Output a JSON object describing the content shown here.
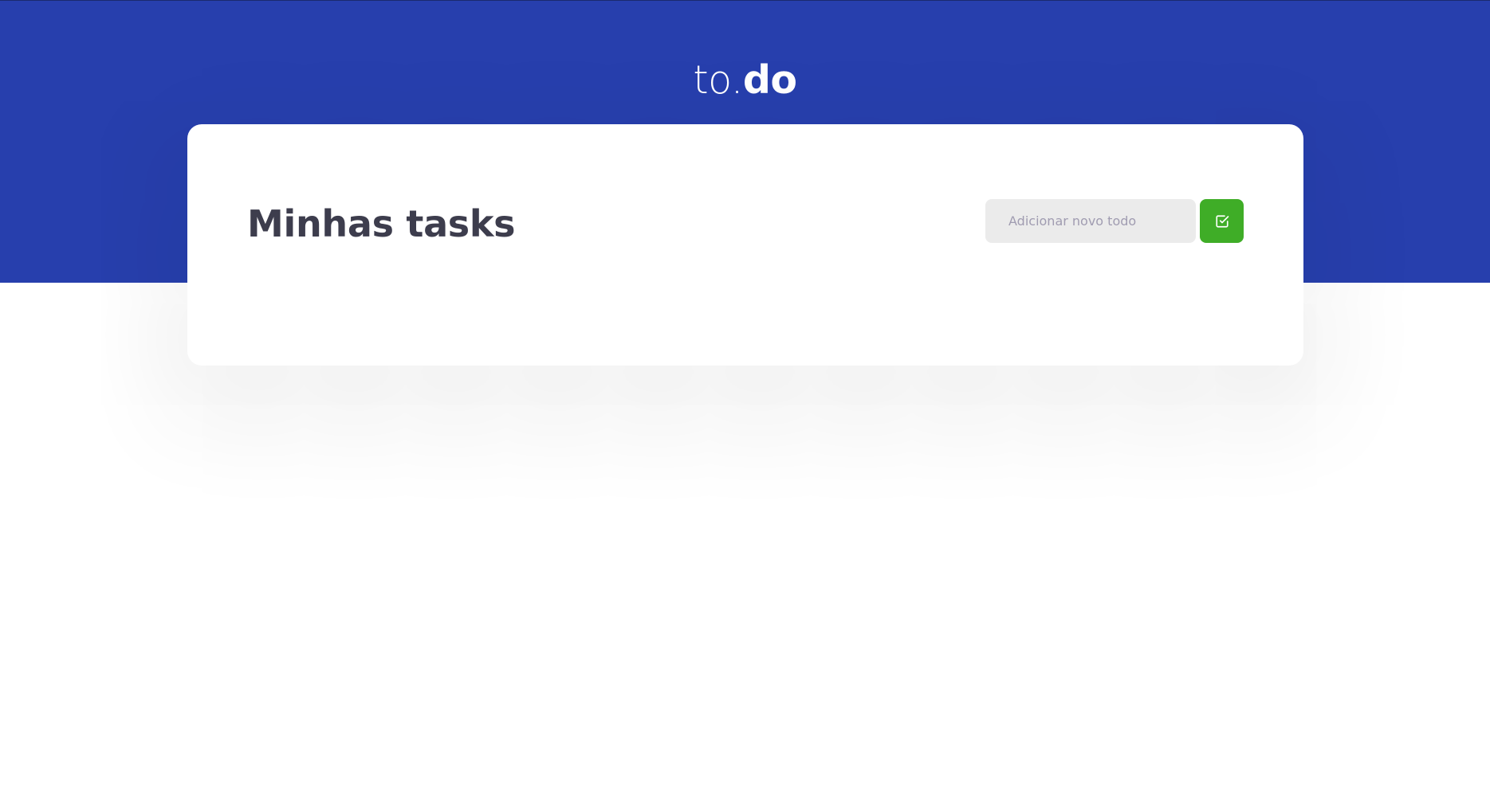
{
  "app": {
    "logo_light": "to.",
    "logo_bold": "do"
  },
  "tasks": {
    "title": "Minhas tasks",
    "input_placeholder": "Adicionar novo todo",
    "input_value": "",
    "add_button_icon": "check-square-icon",
    "items": []
  },
  "colors": {
    "header_bg": "#273fad",
    "accent_green": "#3fad27",
    "title_text": "#3d3d4d",
    "input_bg": "#ebebeb",
    "placeholder_text": "#a09cb1"
  }
}
